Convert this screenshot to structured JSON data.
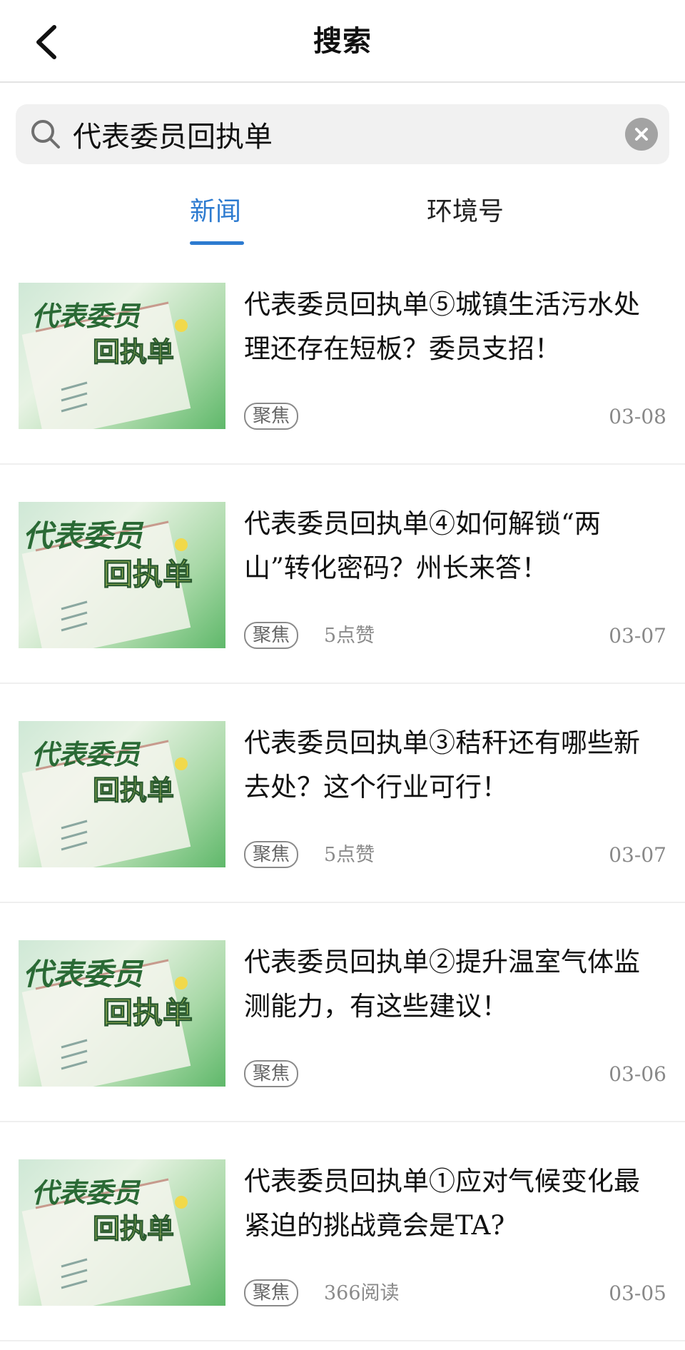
{
  "header": {
    "title": "搜索",
    "back_icon": "chevron-left-icon"
  },
  "search": {
    "value": "代表委员回执单",
    "placeholder": "",
    "search_icon": "search-icon",
    "clear_icon": "clear-icon"
  },
  "tabs": [
    {
      "label": "新闻",
      "active": true
    },
    {
      "label": "环境号",
      "active": false
    }
  ],
  "colors": {
    "accent": "#2d7bd0",
    "text": "#111111",
    "muted": "#888888"
  },
  "news": [
    {
      "title": "代表委员回执单⑤城镇生活污水处理还存在短板？委员支招！",
      "tag": "聚焦",
      "stat": "",
      "date": "03-08",
      "thumb_text_1": "代表委员",
      "thumb_text_2": "回执单"
    },
    {
      "title": "代表委员回执单④如何解锁“两山”转化密码？州长来答！",
      "tag": "聚焦",
      "stat": "5点赞",
      "date": "03-07",
      "thumb_text_1": "代表委员",
      "thumb_text_2": "回执单"
    },
    {
      "title": "代表委员回执单③秸秆还有哪些新去处？这个行业可行！",
      "tag": "聚焦",
      "stat": "5点赞",
      "date": "03-07",
      "thumb_text_1": "代表委员",
      "thumb_text_2": "回执单"
    },
    {
      "title": "代表委员回执单②提升温室气体监测能力，有这些建议！",
      "tag": "聚焦",
      "stat": "",
      "date": "03-06",
      "thumb_text_1": "代表委员",
      "thumb_text_2": "回执单"
    },
    {
      "title": "代表委员回执单①应对气候变化最紧迫的挑战竟会是TA?",
      "tag": "聚焦",
      "stat": "366阅读",
      "date": "03-05",
      "thumb_text_1": "代表委员",
      "thumb_text_2": "回执单"
    }
  ]
}
